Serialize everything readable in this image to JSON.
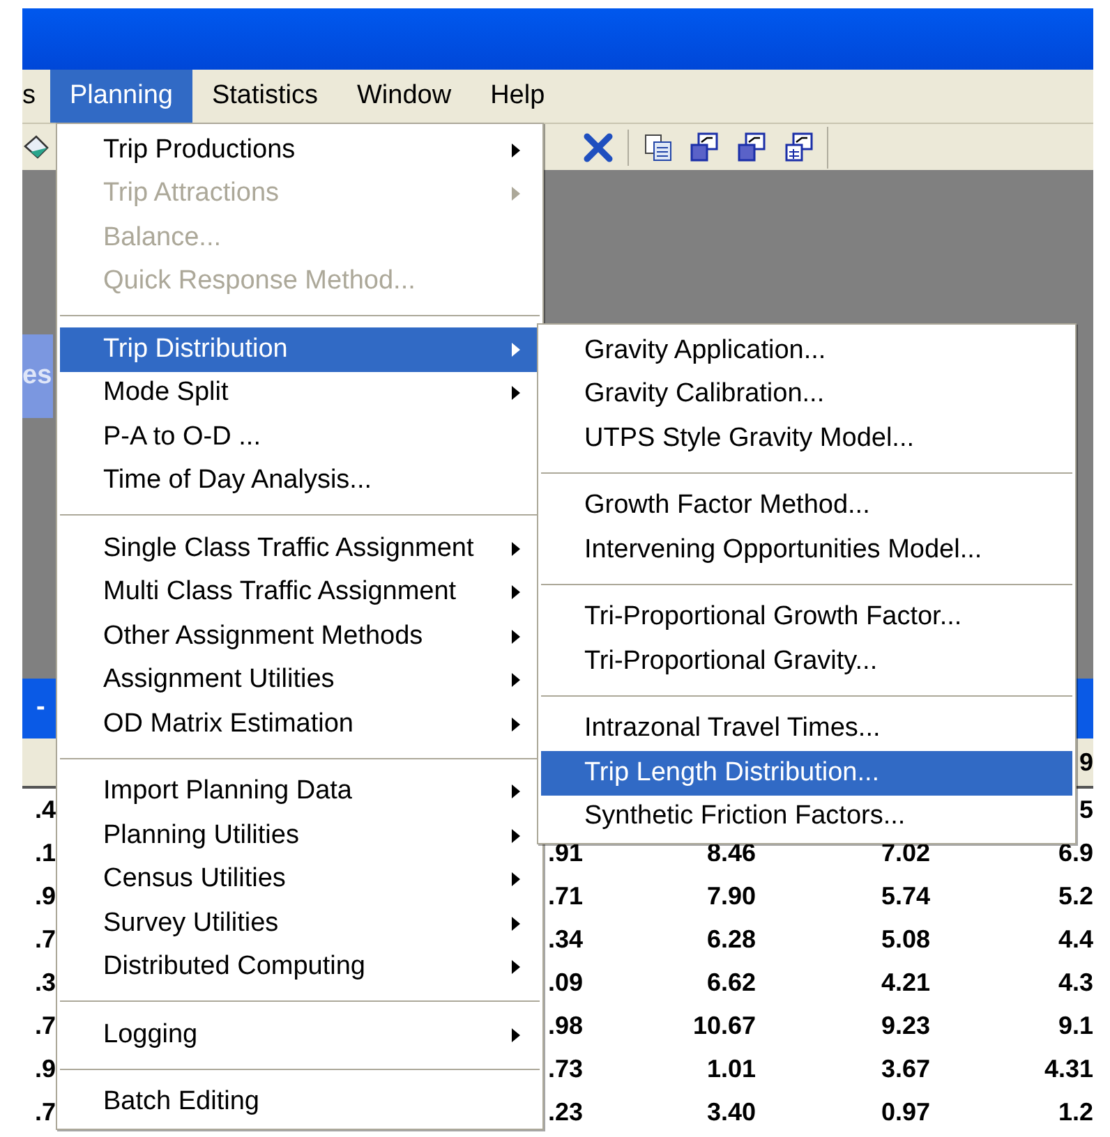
{
  "menubar": [
    {
      "label": "s",
      "selected": false
    },
    {
      "label": "Planning",
      "selected": true
    },
    {
      "label": "Statistics",
      "selected": false
    },
    {
      "label": "Window",
      "selected": false
    },
    {
      "label": "Help",
      "selected": false
    }
  ],
  "inactive_window_title": "es",
  "active_window_title": "-",
  "table": {
    "header": {
      "column_5": "9"
    },
    "rows": [
      {
        "column_1": ".4",
        "column_5": "5"
      },
      {
        "column_1": ".1",
        "column_2": ".91",
        "column_3": "8.46",
        "column_4": "7.02",
        "column_5": "6.9"
      },
      {
        "column_1": ".9",
        "column_2": ".71",
        "column_3": "7.90",
        "column_4": "5.74",
        "column_5": "5.2"
      },
      {
        "column_1": ".7",
        "column_2": ".34",
        "column_3": "6.28",
        "column_4": "5.08",
        "column_5": "4.4"
      },
      {
        "column_1": ".3",
        "column_2": ".09",
        "column_3": "6.62",
        "column_4": "4.21",
        "column_5": "4.3"
      },
      {
        "column_1": ".7",
        "column_2": ".98",
        "column_3": "10.67",
        "column_4": "9.23",
        "column_5": "9.1"
      },
      {
        "column_1": ".9",
        "column_2": ".73",
        "column_3": "1.01",
        "column_4": "3.67",
        "column_5": "4.31"
      },
      {
        "column_1": ".7",
        "column_2": ".23",
        "column_3": "3.40",
        "column_4": "0.97",
        "column_5": "1.2"
      }
    ]
  },
  "planning_menu": {
    "groups": [
      {
        "items": [
          {
            "label": "Trip Productions",
            "disabled": false,
            "submenu": true,
            "selected": false
          },
          {
            "label": "Trip Attractions",
            "disabled": true,
            "submenu": true,
            "selected": false
          },
          {
            "label": "Balance...",
            "disabled": true,
            "submenu": false,
            "selected": false
          },
          {
            "label": "Quick Response Method...",
            "disabled": true,
            "submenu": false,
            "selected": false
          }
        ]
      },
      {
        "items": [
          {
            "label": "Trip Distribution",
            "disabled": false,
            "submenu": true,
            "selected": true
          },
          {
            "label": "Mode Split",
            "disabled": false,
            "submenu": true,
            "selected": false
          },
          {
            "label": "P-A to O-D ...",
            "disabled": false,
            "submenu": false,
            "selected": false
          },
          {
            "label": "Time of Day Analysis...",
            "disabled": false,
            "submenu": false,
            "selected": false
          }
        ]
      },
      {
        "items": [
          {
            "label": "Single Class Traffic Assignment",
            "disabled": false,
            "submenu": true,
            "selected": false
          },
          {
            "label": "Multi Class Traffic Assignment",
            "disabled": false,
            "submenu": true,
            "selected": false
          },
          {
            "label": "Other Assignment Methods",
            "disabled": false,
            "submenu": true,
            "selected": false
          },
          {
            "label": "Assignment Utilities",
            "disabled": false,
            "submenu": true,
            "selected": false
          },
          {
            "label": "OD Matrix Estimation",
            "disabled": false,
            "submenu": true,
            "selected": false
          }
        ]
      },
      {
        "items": [
          {
            "label": "Import Planning Data",
            "disabled": false,
            "submenu": true,
            "selected": false
          },
          {
            "label": "Planning Utilities",
            "disabled": false,
            "submenu": true,
            "selected": false
          },
          {
            "label": "Census Utilities",
            "disabled": false,
            "submenu": true,
            "selected": false
          },
          {
            "label": "Survey Utilities",
            "disabled": false,
            "submenu": true,
            "selected": false
          },
          {
            "label": "Distributed Computing",
            "disabled": false,
            "submenu": true,
            "selected": false
          }
        ]
      },
      {
        "items": [
          {
            "label": "Logging",
            "disabled": false,
            "submenu": true,
            "selected": false
          }
        ]
      },
      {
        "items": [
          {
            "label": "Batch Editing",
            "disabled": false,
            "submenu": false,
            "selected": false
          }
        ]
      }
    ]
  },
  "trip_distribution_submenu": {
    "groups": [
      {
        "items": [
          {
            "label": "Gravity Application...",
            "disabled": false,
            "submenu": false,
            "selected": false
          },
          {
            "label": "Gravity Calibration...",
            "disabled": false,
            "submenu": false,
            "selected": false
          },
          {
            "label": "UTPS Style Gravity Model...",
            "disabled": false,
            "submenu": false,
            "selected": false
          }
        ]
      },
      {
        "items": [
          {
            "label": "Growth Factor Method...",
            "disabled": false,
            "submenu": false,
            "selected": false
          },
          {
            "label": "Intervening Opportunities Model...",
            "disabled": false,
            "submenu": false,
            "selected": false
          }
        ]
      },
      {
        "items": [
          {
            "label": "Tri-Proportional Growth Factor...",
            "disabled": false,
            "submenu": false,
            "selected": false
          },
          {
            "label": "Tri-Proportional Gravity...",
            "disabled": false,
            "submenu": false,
            "selected": false
          }
        ]
      },
      {
        "items": [
          {
            "label": "Intrazonal Travel Times...",
            "disabled": false,
            "submenu": false,
            "selected": false
          },
          {
            "label": "Trip Length Distribution...",
            "disabled": false,
            "submenu": false,
            "selected": true
          },
          {
            "label": "Synthetic Friction Factors...",
            "disabled": false,
            "submenu": false,
            "selected": false
          }
        ]
      }
    ]
  }
}
